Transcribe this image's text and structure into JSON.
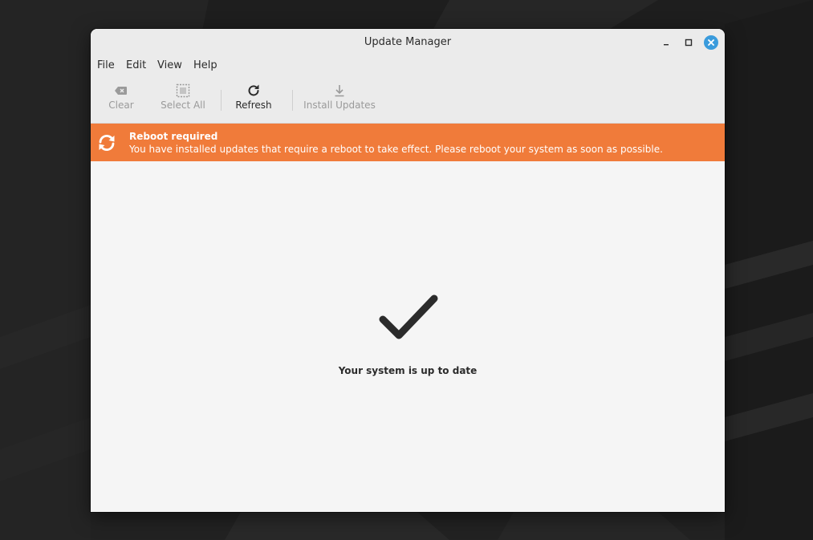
{
  "window": {
    "title": "Update Manager"
  },
  "menubar": {
    "items": [
      {
        "label": "File"
      },
      {
        "label": "Edit"
      },
      {
        "label": "View"
      },
      {
        "label": "Help"
      }
    ]
  },
  "toolbar": {
    "clear_label": "Clear",
    "select_all_label": "Select All",
    "refresh_label": "Refresh",
    "install_updates_label": "Install Updates"
  },
  "infobar": {
    "title": "Reboot required",
    "message": "You have installed updates that require a reboot to take effect. Please reboot your system as soon as possible.",
    "color": "#f07b3a",
    "icon": "reboot-icon"
  },
  "main": {
    "status": "Your system is up to date",
    "icon": "checkmark-icon"
  },
  "colors": {
    "accent_close": "#3a9bdc",
    "infobar_bg": "#f07b3a",
    "disabled_text": "#9a9a9a"
  }
}
